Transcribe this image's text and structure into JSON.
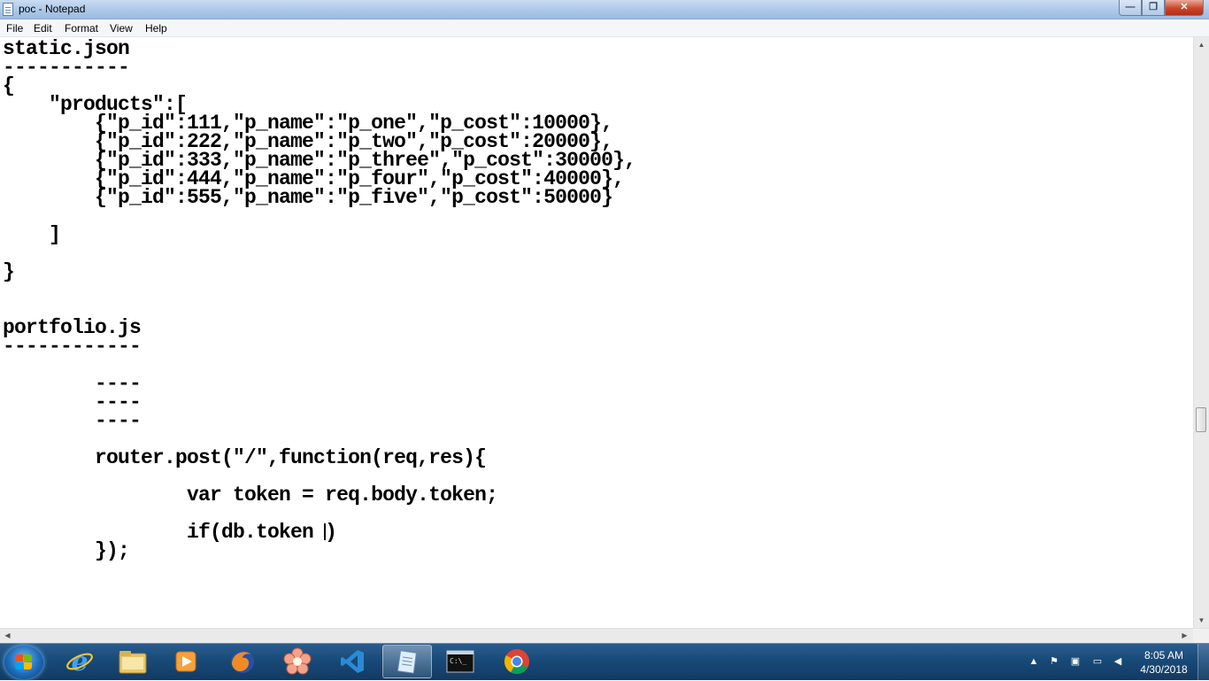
{
  "window": {
    "title": "poc - Notepad",
    "buttons": {
      "minimize": "—",
      "maximize": "❐",
      "close": "✕"
    }
  },
  "menu": [
    "File",
    "Edit",
    "Format",
    "View",
    "Help"
  ],
  "editor": {
    "lines": [
      "static.json",
      "-----------",
      "{",
      "    \"products\":[",
      "        {\"p_id\":111,\"p_name\":\"p_one\",\"p_cost\":10000},",
      "        {\"p_id\":222,\"p_name\":\"p_two\",\"p_cost\":20000},",
      "        {\"p_id\":333,\"p_name\":\"p_three\",\"p_cost\":30000},",
      "        {\"p_id\":444,\"p_name\":\"p_four\",\"p_cost\":40000},",
      "        {\"p_id\":555,\"p_name\":\"p_five\",\"p_cost\":50000}",
      "",
      "    ]",
      "",
      "}",
      "",
      "",
      "portfolio.js",
      "------------",
      "",
      "        ----",
      "        ----",
      "        ----",
      "",
      "        router.post(\"/\",function(req,res){",
      "",
      "                var token = req.body.token;",
      "",
      "                if(db.token ",
      "        });"
    ],
    "cursor_line_suffix": ")"
  },
  "taskbar": {
    "apps": [
      "internet-explorer-icon",
      "explorer-icon",
      "media-player-icon",
      "firefox-icon",
      "app-flower-icon",
      "vscode-icon",
      "notepad-icon",
      "cmd-icon",
      "chrome-icon"
    ],
    "tray_icons": [
      "show-hidden-icons-icon",
      "action-center-icon",
      "safely-remove-icon",
      "network-icon",
      "volume-icon"
    ],
    "time": "8:05 AM",
    "date": "4/30/2018"
  },
  "colors": {
    "titlebar": "#aac6e8",
    "taskbar": "#184a78",
    "text": "#000000"
  }
}
